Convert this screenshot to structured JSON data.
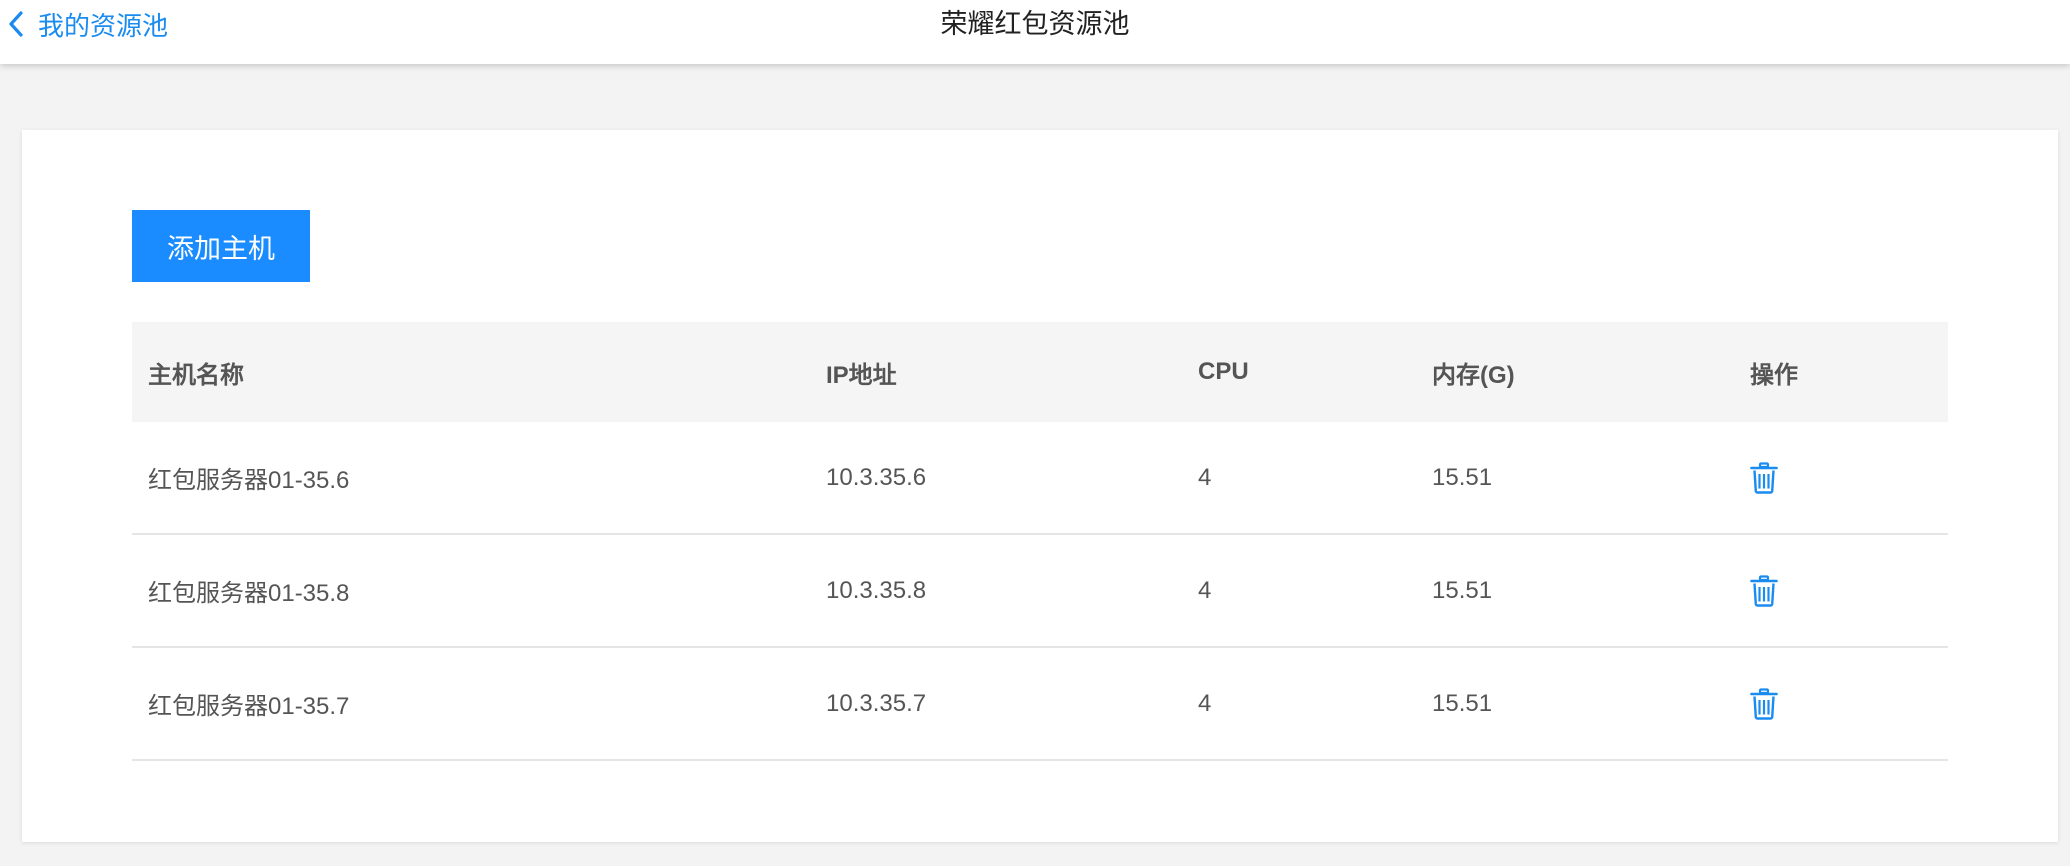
{
  "header": {
    "back_label": "我的资源池",
    "title": "荣耀红包资源池"
  },
  "toolbar": {
    "add_host_label": "添加主机"
  },
  "table": {
    "columns": [
      "主机名称",
      "IP地址",
      "CPU",
      "内存(G)",
      "操作"
    ],
    "rows": [
      {
        "name": "红包服务器01-35.6",
        "ip": "10.3.35.6",
        "cpu": "4",
        "memory": "15.51",
        "action_icon": "trash-icon"
      },
      {
        "name": "红包服务器01-35.8",
        "ip": "10.3.35.8",
        "cpu": "4",
        "memory": "15.51",
        "action_icon": "trash-icon"
      },
      {
        "name": "红包服务器01-35.7",
        "ip": "10.3.35.7",
        "cpu": "4",
        "memory": "15.51",
        "action_icon": "trash-icon"
      }
    ]
  },
  "colors": {
    "accent": "#1a8cff",
    "link": "#1a8cf0",
    "header_bg": "#f5f5f5",
    "page_bg": "#f3f3f3"
  }
}
